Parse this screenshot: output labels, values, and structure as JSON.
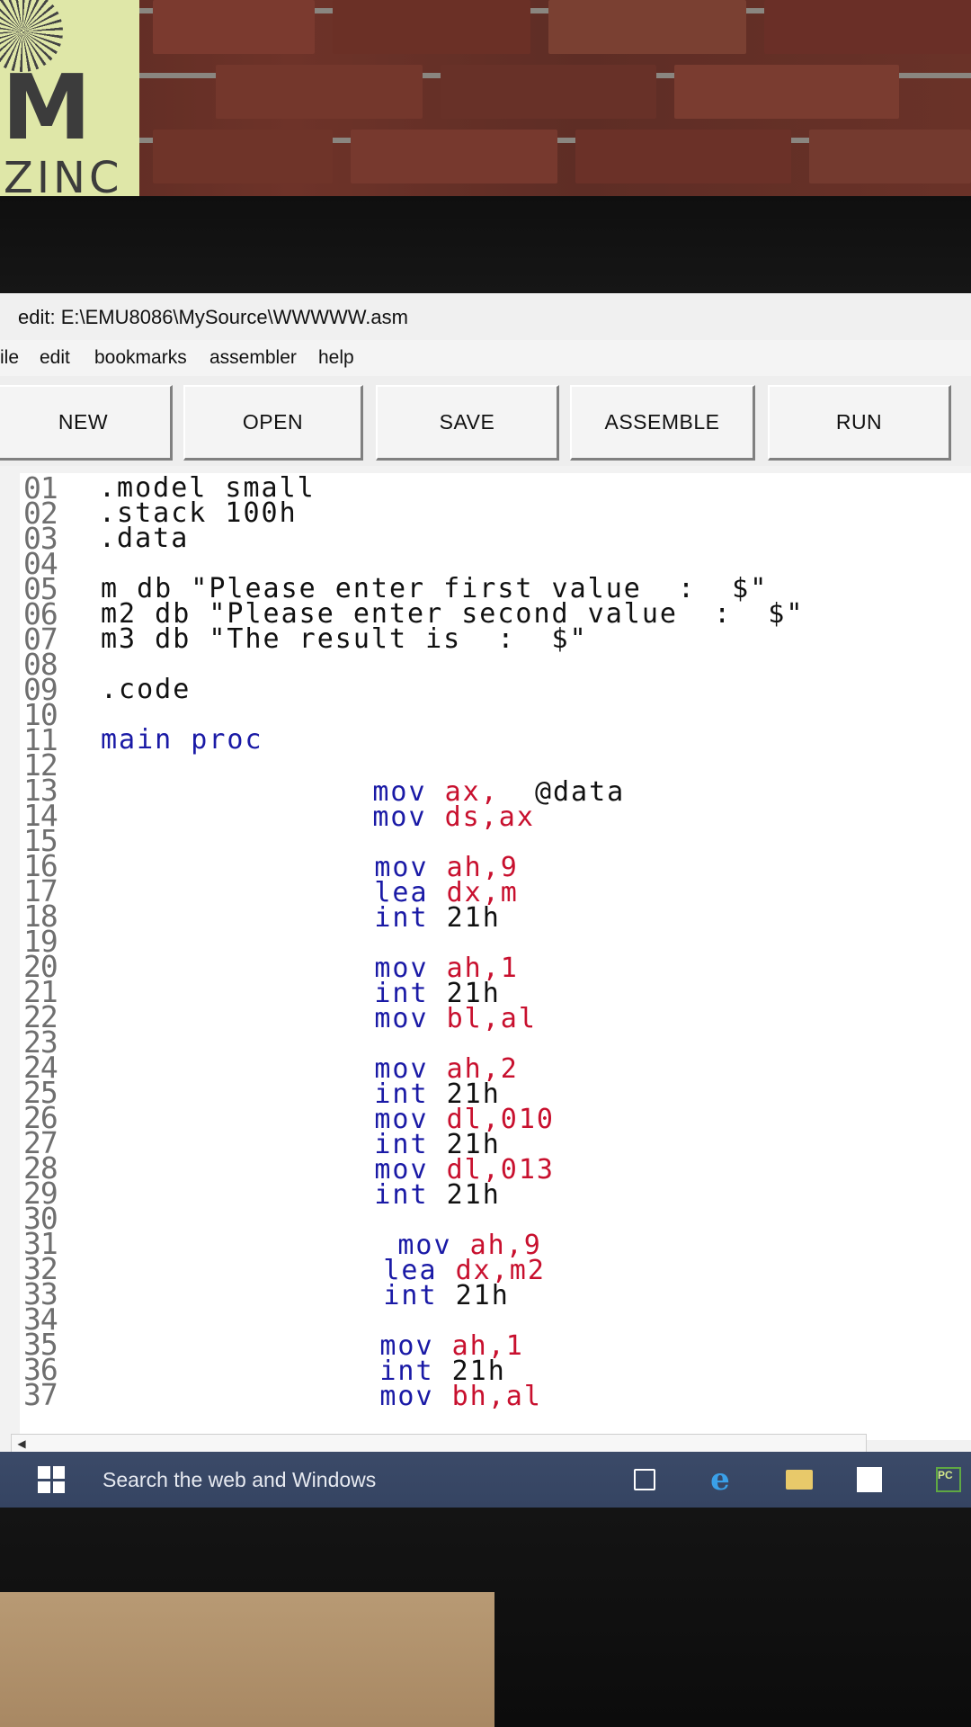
{
  "window": {
    "title": "edit: E:\\EMU8086\\MySource\\WWWWW.asm"
  },
  "menu": [
    "ile",
    "edit",
    "bookmarks",
    "assembler",
    "help"
  ],
  "toolbar": {
    "new": "NEW",
    "open": "OPEN",
    "save": "SAVE",
    "assemble": "ASSEMBLE",
    "run": "RUN"
  },
  "line_numbers": [
    "01",
    "02",
    "03",
    "04",
    "05",
    "06",
    "07",
    "08",
    "09",
    "10",
    "11",
    "12",
    "13",
    "14",
    "15",
    "16",
    "17",
    "18",
    "19",
    "20",
    "21",
    "22",
    "23",
    "24",
    "25",
    "26",
    "27",
    "28",
    "29",
    "30",
    "31",
    "32",
    "33",
    "34",
    "35",
    "36",
    "37"
  ],
  "code": {
    "l01": ".model small",
    "l02": ".stack 100h",
    "l03": ".data",
    "l05": "m db \"Please enter first value  :  $\"",
    "l06": "m2 db \"Please enter second value  :  $\"",
    "l07": "m3 db \"The result is  :  $\"",
    "l09": ".code",
    "l11": "main proc",
    "l12_op": "mov",
    "l12_arg": "ax,",
    "l12_rest": "@data",
    "l13_op": "mov",
    "l13_arg": "ds,ax",
    "l15_op": "mov",
    "l15_arg": "ah,9",
    "l16_op": "lea",
    "l16_arg": "dx,m",
    "l17_op": "int",
    "l17_arg": "21h",
    "l19_op": "mov",
    "l19_arg": "ah,1",
    "l20_op": "int",
    "l20_arg": "21h",
    "l21_op": "mov",
    "l21_arg": "bl,al",
    "l23_op": "mov",
    "l23_arg": "ah,2",
    "l24_op": "int",
    "l24_arg": "21h",
    "l25_op": "mov",
    "l25_arg": "dl,010",
    "l26_op": "int",
    "l26_arg": "21h",
    "l27_op": "mov",
    "l27_arg": "dl,013",
    "l28_op": "int",
    "l28_arg": "21h",
    "l30_op": "mov",
    "l30_arg": "ah,9",
    "l31_op": "lea",
    "l31_arg": "dx,m2",
    "l32_op": "int",
    "l32_arg": "21h",
    "l34_op": "mov",
    "l34_arg": "ah,1",
    "l35_op": "int",
    "l35_arg": "21h",
    "l36_op": "mov",
    "l36_arg": "bh,al"
  },
  "taskbar": {
    "search_placeholder": "Search the web and Windows",
    "pc_badge": "PC"
  },
  "poster": {
    "letter": "M",
    "sub": "ZINC"
  },
  "colors": {
    "keyword": "#1a1aa6",
    "register": "#c8102e",
    "taskbar": "#3b4a68"
  }
}
